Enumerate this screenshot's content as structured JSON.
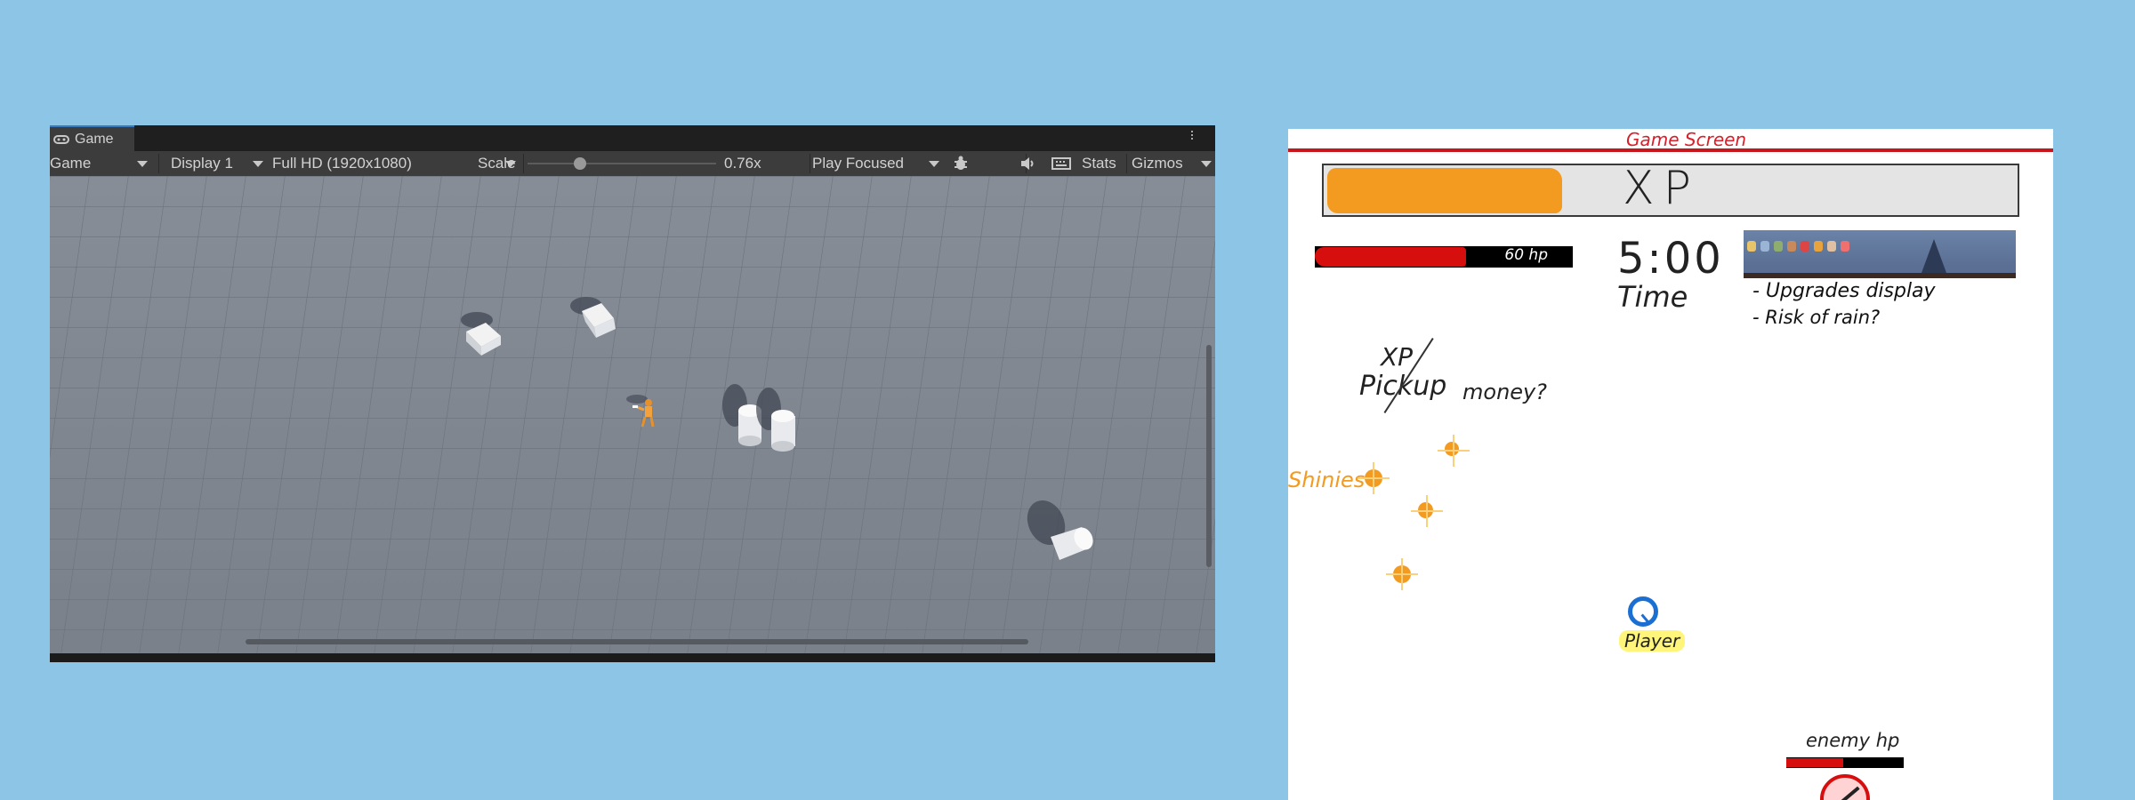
{
  "colors": {
    "page_background": "#8cc5e6",
    "unity_toolbar": "#3c3c3c",
    "tab_accent": "#3a79bb",
    "xp_orange": "#f39a20",
    "hp_red": "#d70e0e",
    "title_red": "#d8202a",
    "player_blue": "#1b6fd2",
    "player_highlight": "#fff57a"
  },
  "game_window": {
    "tab_label": "Game",
    "tab_icon": "game-controller-icon",
    "menu_icon": "kebab-menu-icon",
    "toolbar": {
      "view_mode": "Game",
      "display": "Display 1",
      "resolution": "Full HD (1920x1080)",
      "scale_label": "Scale",
      "scale_value": "0.76x",
      "scale_fraction": 0.28,
      "play_mode": "Play Focused",
      "bug_icon": "bug-icon",
      "audio_icon": "speaker-icon",
      "keyboard_icon": "keyboard-icon",
      "stats_label": "Stats",
      "gizmos_label": "Gizmos"
    }
  },
  "sketch": {
    "title": "Game Screen",
    "xp_bar_label": "XP",
    "hp_text": "60 hp",
    "timer": "5:00",
    "time_label": "Time",
    "upgrade_notes": [
      "- Upgrades display",
      "- Risk of rain?"
    ],
    "xp_note_top": "XP",
    "xp_note_pickup": "Pickup",
    "xp_note_money": "money?",
    "shinies_label": "Shinies",
    "player_label": "Player",
    "enemy_hp_label": "enemy hp"
  }
}
